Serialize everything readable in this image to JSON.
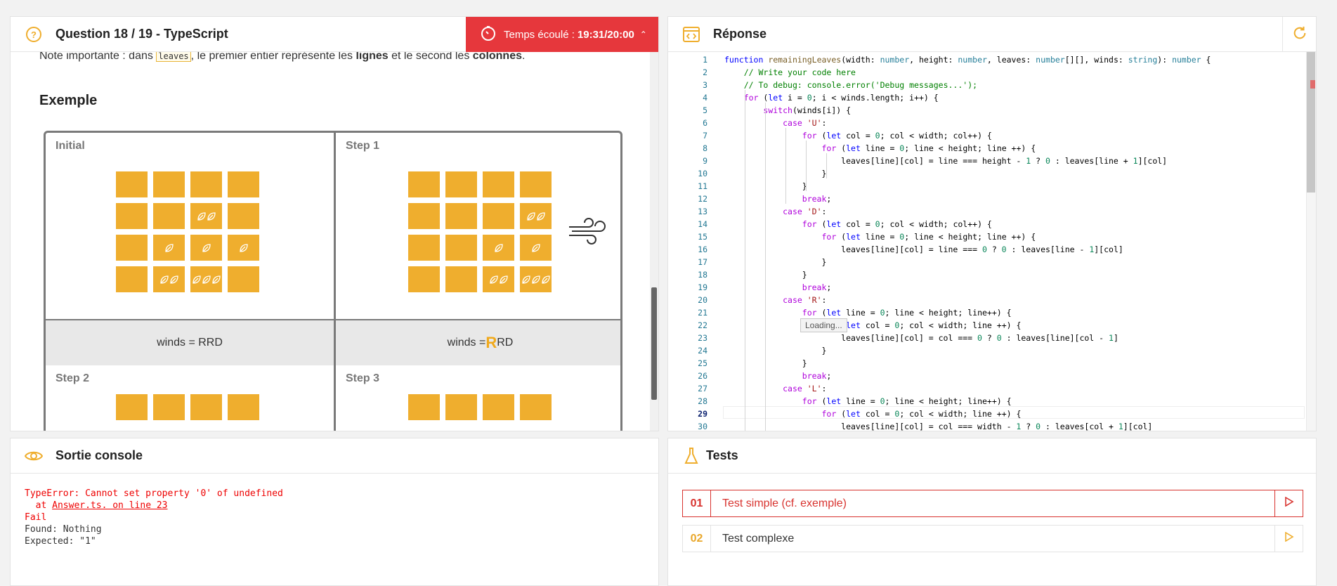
{
  "question": {
    "title": "Question 18 / 19 - TypeScript",
    "timer_label": "Temps écoulé :",
    "timer_value": "19:31/20:00",
    "note_pre": "Note importante : dans ",
    "note_code": "leaves",
    "note_mid": ", le premier entier représente les ",
    "note_b1": "lignes",
    "note_mid2": " et le second les ",
    "note_b2": "colonnes",
    "note_end": ".",
    "example_title": "Exemple",
    "cells": {
      "initial": "Initial",
      "step1": "Step 1",
      "step2": "Step 2",
      "step3": "Step 3"
    },
    "winds_initial": "winds = RRD",
    "winds_step1_pre": "winds = ",
    "winds_step1_big": "R",
    "winds_step1_post": "RD"
  },
  "answer": {
    "title": "Réponse",
    "loading": "Loading...",
    "code": [
      "function remainingLeaves(width: number, height: number, leaves: number[][], winds: string): number {",
      "    // Write your code here",
      "    // To debug: console.error('Debug messages...');",
      "    for (let i = 0; i < winds.length; i++) {",
      "        switch(winds[i]) {",
      "            case 'U':",
      "                for (let col = 0; col < width; col++) {",
      "                    for (let line = 0; line < height; line ++) {",
      "                        leaves[line][col] = line === height - 1 ? 0 : leaves[line + 1][col]",
      "                    }",
      "                }",
      "                break;",
      "            case 'D':",
      "                for (let col = 0; col < width; col++) {",
      "                    for (let line = 0; line < height; line ++) {",
      "                        leaves[line][col] = line === 0 ? 0 : leaves[line - 1][col]",
      "                    }",
      "                }",
      "                break;",
      "            case 'R':",
      "                for (let line = 0; line < height; line++) {",
      "                    for (let col = 0; col < width; line ++) {",
      "                        leaves[line][col] = col === 0 ? 0 : leaves[line][col - 1]",
      "                    }",
      "                }",
      "                break;",
      "            case 'L':",
      "                for (let line = 0; line < height; line++) {",
      "                    for (let col = 0; col < width; line ++) {",
      "                        leaves[line][col] = col === width - 1 ? 0 : leaves[col + 1][col]"
    ]
  },
  "console": {
    "title": "Sortie console",
    "line1": "TypeError: Cannot set property '0' of undefined",
    "line2_pre": "  at ",
    "line2_link": "Answer.ts. on line 23",
    "line3": "Fail",
    "line4": "Found: Nothing",
    "line5": "Expected: \"1\""
  },
  "tests": {
    "title": "Tests",
    "items": [
      {
        "num": "01",
        "name": "Test simple (cf. exemple)"
      },
      {
        "num": "02",
        "name": "Test complexe"
      }
    ]
  },
  "colors": {
    "accent": "#efae2e",
    "danger": "#e6373c",
    "tile": "#efae2e"
  }
}
